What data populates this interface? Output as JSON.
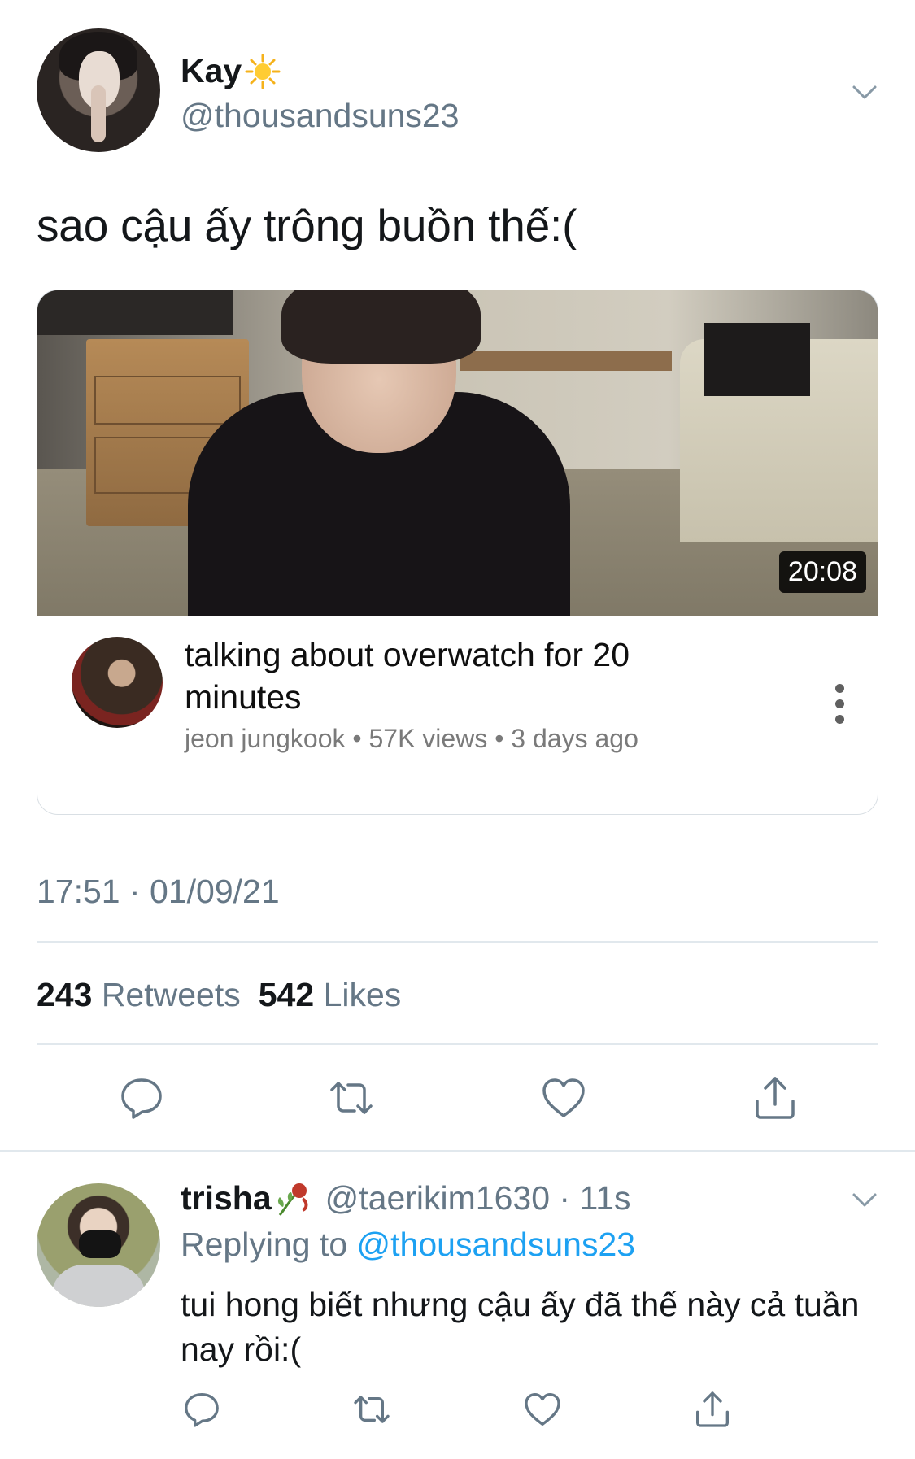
{
  "tweet": {
    "author_name": "Kay",
    "author_emoji": "☀️",
    "author_handle": "@thousandsuns23",
    "text": "sao cậu ấy trông buồn thế:(",
    "timestamp": "17:51 · 01/09/21",
    "stats": {
      "retweets_count": "243",
      "retweets_label": "Retweets",
      "likes_count": "542",
      "likes_label": "Likes"
    },
    "actions": [
      "reply-icon",
      "retweet-icon",
      "like-icon",
      "share-icon"
    ]
  },
  "video_card": {
    "duration": "20:08",
    "title": "talking about overwatch for 20 minutes",
    "channel": "jeon jungkook",
    "views": "57K views",
    "age": "3 days ago",
    "meta": "jeon jungkook • 57K views • 3 days ago"
  },
  "reply": {
    "name": "trisha",
    "emoji": "🥀",
    "handle_time": "@taerikim1630 · 11s",
    "replying_prefix": "Replying to",
    "replying_to": "@thousandsuns23",
    "text": "tui hong biết nhưng cậu ấy đã thế này cả tuần nay rồi:(",
    "actions": [
      "reply-icon",
      "retweet-icon",
      "like-icon",
      "share-icon"
    ]
  },
  "colors": {
    "text_primary": "#14171a",
    "text_secondary": "#657786",
    "link": "#1da1f2",
    "divider": "#e1e8ed"
  }
}
